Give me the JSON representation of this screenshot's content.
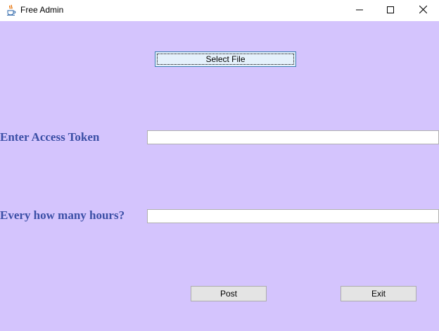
{
  "window": {
    "title": "Free Admin",
    "app_icon": "java-cup-icon",
    "controls": {
      "minimize_icon": "minimize-icon",
      "maximize_icon": "maximize-icon",
      "close_icon": "close-icon"
    }
  },
  "main": {
    "select_file_label": "Select File",
    "access_token": {
      "label": "Enter Access Token",
      "value": ""
    },
    "hours": {
      "label": "Every how many hours?",
      "value": ""
    },
    "post_label": "Post",
    "exit_label": "Exit"
  },
  "colors": {
    "background": "#d4c4fd",
    "label_text": "#3b4fa6",
    "button_face": "#e4e4e4",
    "focused_button_face": "#e5f1fb"
  }
}
